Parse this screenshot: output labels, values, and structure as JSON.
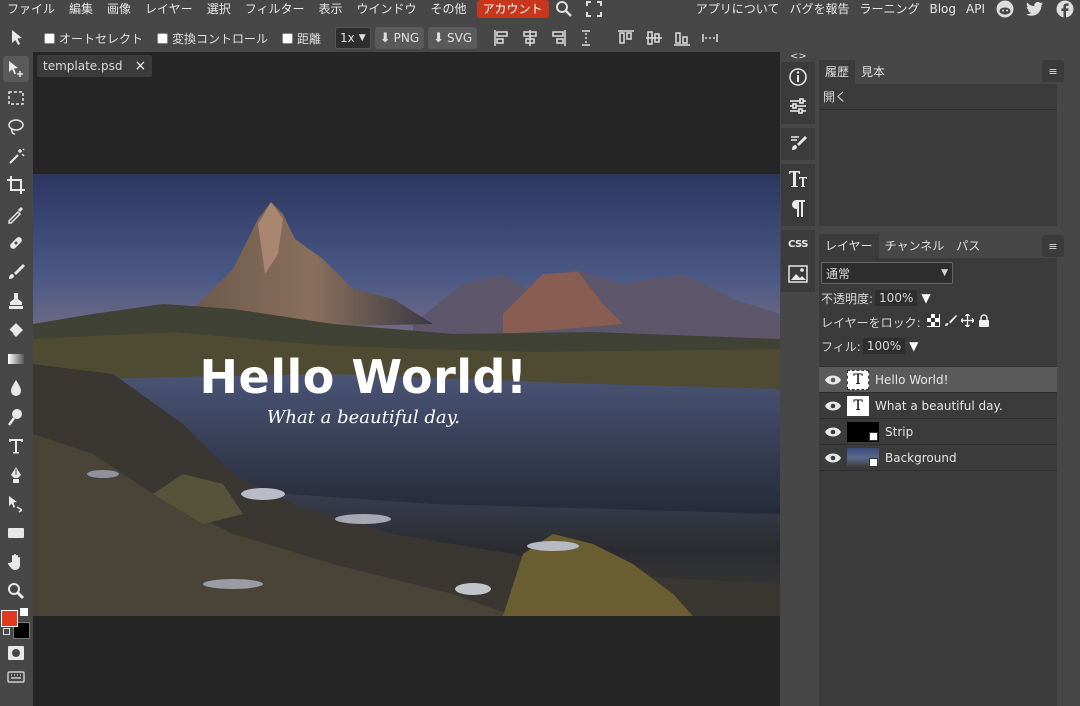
{
  "menu": {
    "items": [
      "ファイル",
      "編集",
      "画像",
      "レイヤー",
      "選択",
      "フィルター",
      "表示",
      "ウインドウ",
      "その他"
    ],
    "account": "アカウント",
    "right_items": [
      "アプリについて",
      "バグを報告",
      "ラーニング",
      "Blog",
      "API"
    ]
  },
  "options": {
    "auto_select": "オートセレクト",
    "transform_controls": "変換コントロール",
    "distances": "距離",
    "zoom": "1x",
    "png": "PNG",
    "svg": "SVG"
  },
  "document": {
    "tab_name": "template.psd",
    "close": "×",
    "canvas_title": "Hello World!",
    "canvas_subtitle": "What a beautiful day."
  },
  "history_panel": {
    "tabs": [
      "履歴",
      "見本"
    ],
    "items": [
      "開く"
    ]
  },
  "layers_panel": {
    "tabs": [
      "レイヤー",
      "チャンネル",
      "パス"
    ],
    "blend_mode": "通常",
    "opacity_label": "不透明度:",
    "opacity_value": "100%",
    "lock_label": "レイヤーをロック:",
    "fill_label": "フィル:",
    "fill_value": "100%",
    "layers": [
      {
        "name": "Hello World!",
        "type": "text"
      },
      {
        "name": "What a beautiful day.",
        "type": "text"
      },
      {
        "name": "Strip",
        "type": "raster"
      },
      {
        "name": "Background",
        "type": "raster"
      }
    ]
  },
  "colors": {
    "foreground": "#e03a1e",
    "background": "#000000",
    "accent": "#c8361b"
  },
  "collapse": {
    "left": "<>",
    "right": "><"
  },
  "tool_icons": [
    "move-tool-icon",
    "marquee-tool-icon",
    "lasso-tool-icon",
    "magic-wand-icon",
    "crop-tool-icon",
    "eyedropper-icon",
    "healing-brush-icon",
    "brush-tool-icon",
    "clone-stamp-icon",
    "eraser-icon",
    "gradient-tool-icon",
    "blur-tool-icon",
    "dodge-tool-icon",
    "type-tool-icon",
    "pen-tool-icon",
    "path-select-icon",
    "rectangle-tool-icon",
    "hand-tool-icon",
    "zoom-tool-icon"
  ]
}
